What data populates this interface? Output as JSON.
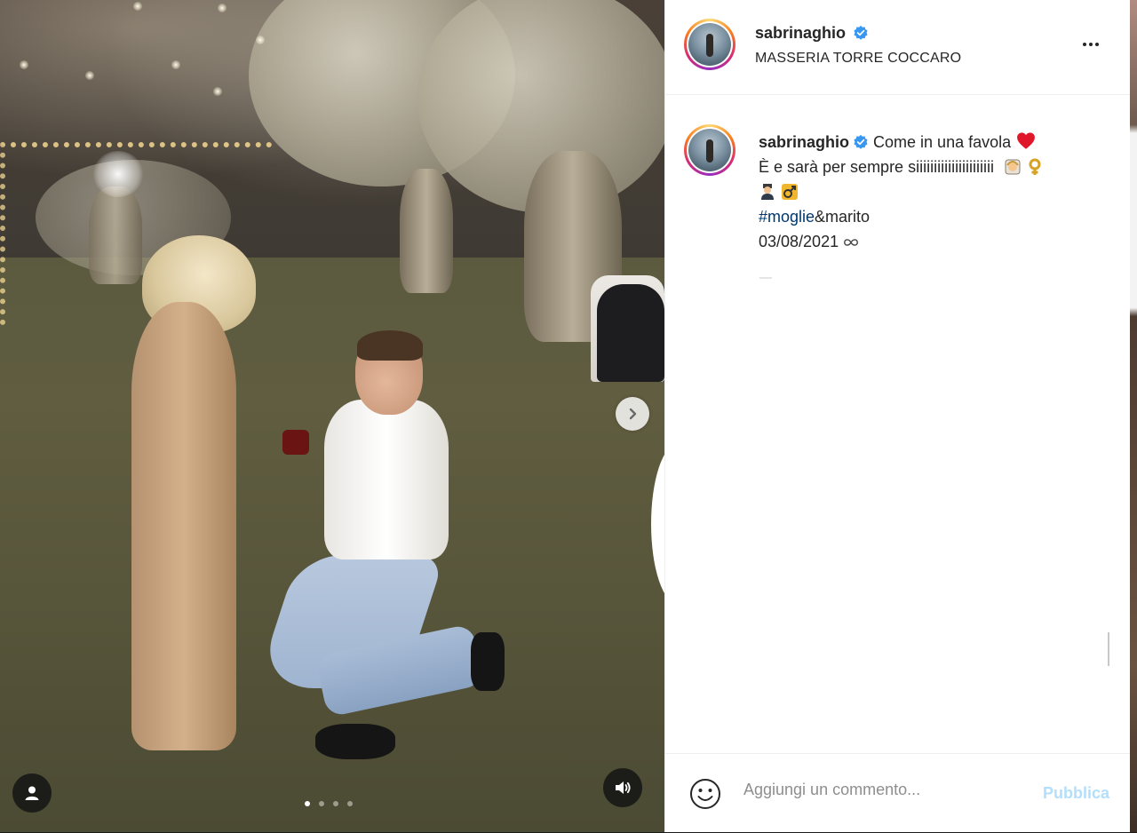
{
  "post": {
    "author": {
      "username": "sabrinaghio",
      "verified": true,
      "location": "MASSERIA TORRE COCCARO"
    },
    "caption": {
      "username": "sabrinaghio",
      "line1_text": "Come in una favola",
      "line2_text": "È e sarà per sempre siiiiiiiiiiiiiiiiiiiiii",
      "hashtag": "#moglie",
      "hashtag_suffix": "&marito",
      "date_text": "03/08/2021",
      "emojis": [
        "heart-emoji",
        "bride-emoji",
        "female-sign-emoji",
        "groom-emoji",
        "male-sign-emoji",
        "infinity-emoji"
      ]
    },
    "carousel": {
      "slide_count": 4,
      "active_index": 0
    },
    "comment_box": {
      "placeholder": "Aggiungi un commento...",
      "publish_label": "Pubblica"
    },
    "colors": {
      "accent_blue": "#0095f6",
      "publish_disabled": "#b2dffc",
      "hashtag": "#00376b",
      "verified_badge": "#3897f0",
      "heart": "#e0162b"
    }
  }
}
